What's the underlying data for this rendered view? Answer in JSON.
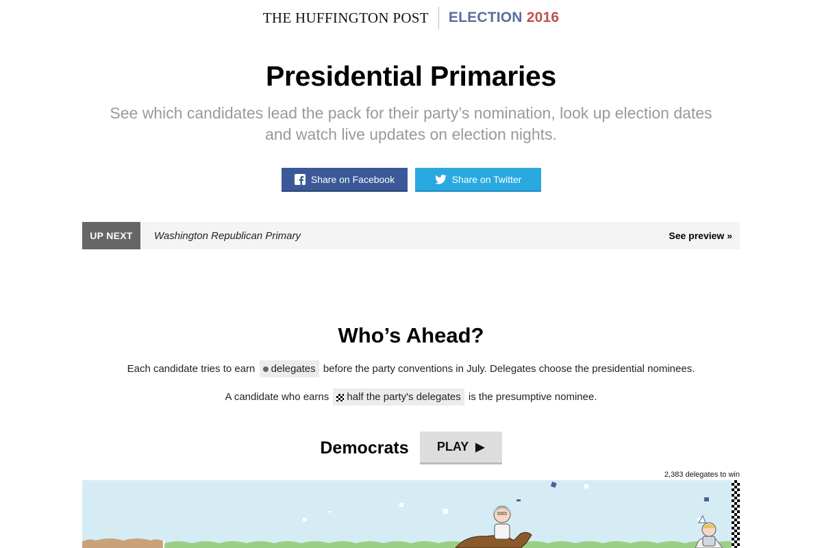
{
  "masthead": {
    "brand": "THE HUFFINGTON POST",
    "election_word": "ELECTION",
    "election_year": "2016"
  },
  "header": {
    "title": "Presidential Primaries",
    "subtitle": "See which candidates lead the pack for their party’s nomination, look up election dates and watch live updates on election nights."
  },
  "share": {
    "facebook_label": "Share on Facebook",
    "twitter_label": "Share on Twitter"
  },
  "up_next": {
    "tag": "UP NEXT",
    "race": "Washington Republican Primary",
    "preview_label": "See preview »"
  },
  "ahead": {
    "title": "Who’s Ahead?",
    "line1_pre": "Each candidate tries to earn",
    "line1_pill": "delegates",
    "line1_post": "before the party conventions in July. Delegates choose the presidential nominees.",
    "line2_pre": "A candidate who earns",
    "line2_pill": "half the party's delegates",
    "line2_post": "is the presumptive nominee."
  },
  "democrats": {
    "label": "Democrats",
    "play_label": "PLAY",
    "play_icon": "play-icon",
    "delegates_to_win": "2,383 delegates to win"
  },
  "colors": {
    "facebook": "#3b5998",
    "twitter": "#2aa9e0",
    "election_word": "#5a6d9c",
    "election_year": "#c0504d",
    "sky": "#d6ecf5",
    "grass": "#9ccf86"
  }
}
